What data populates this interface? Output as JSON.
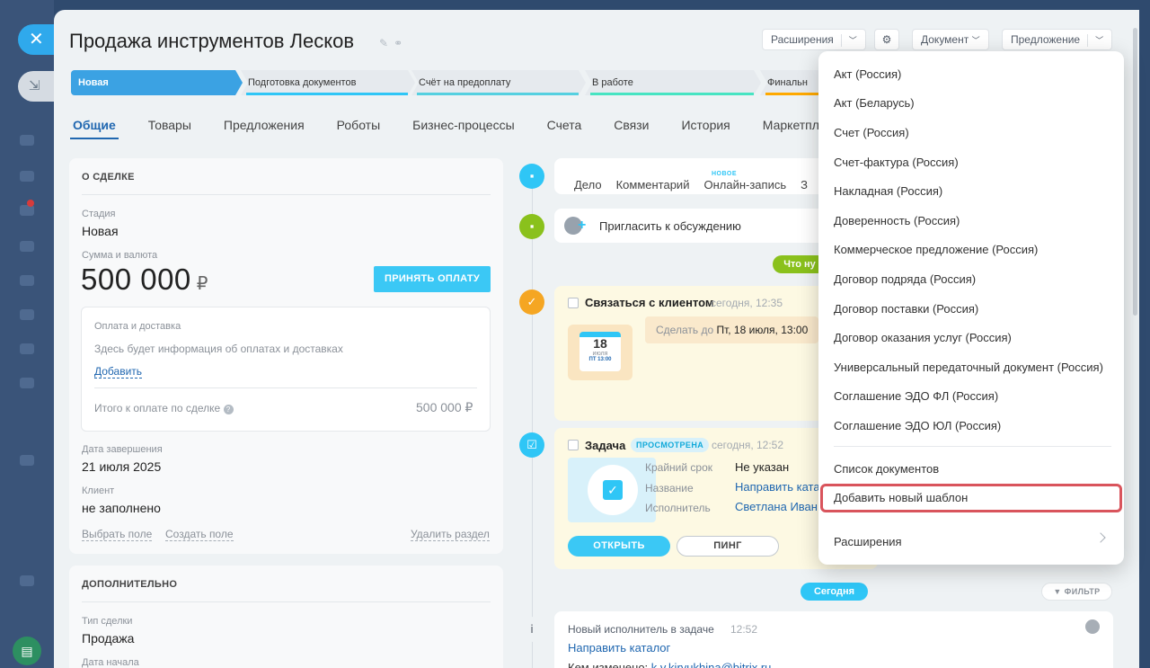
{
  "deal": {
    "title": "Продажа инструментов Лесков"
  },
  "header": {
    "extensions_label": "Расширения",
    "document_label": "Документ",
    "offer_label": "Предложение"
  },
  "stages": [
    {
      "label": "Новая",
      "color": "#3ba2e3"
    },
    {
      "label": "Подготовка документов",
      "color": "#2fc6f6"
    },
    {
      "label": "Счёт на предоплату",
      "color": "#55d0e0"
    },
    {
      "label": "В работе",
      "color": "#47e4c2"
    },
    {
      "label": "Финальн",
      "color": "#ffa900"
    }
  ],
  "tabs": [
    "Общие",
    "Товары",
    "Предложения",
    "Роботы",
    "Бизнес-процессы",
    "Счета",
    "Связи",
    "История",
    "Маркетплейс"
  ],
  "about": {
    "heading": "О СДЕЛКЕ",
    "stage_label": "Стадия",
    "stage_value": "Новая",
    "amount_label": "Сумма и валюта",
    "amount_value": "500 000",
    "currency": "₽",
    "accept_payment": "ПРИНЯТЬ ОПЛАТУ",
    "payment_title": "Оплата и доставка",
    "payment_hint": "Здесь будет информация об оплатах и доставках",
    "add_link": "Добавить",
    "total_label": "Итого к оплате по сделке",
    "total_value": "500 000 ₽",
    "close_date_label": "Дата завершения",
    "close_date_value": "21 июля 2025",
    "client_label": "Клиент",
    "client_value": "не заполнено",
    "choose_field": "Выбрать поле",
    "create_field": "Создать поле",
    "delete_section": "Удалить раздел"
  },
  "extra": {
    "heading": "ДОПОЛНИТЕЛЬНО",
    "type_label": "Тип сделки",
    "type_value": "Продажа",
    "start_label": "Дата начала"
  },
  "timeline": {
    "tabs": [
      "Дело",
      "Комментарий",
      "Онлайн-запись",
      "З"
    ],
    "new_badge": "НОВОЕ",
    "invite": "Пригласить к обсуждению",
    "pill_todo": "Что ну",
    "activity": {
      "title": "Связаться с клиентом",
      "time": "сегодня, 12:35",
      "cal_day": "18",
      "cal_month": "июля",
      "cal_footer": "ПТ 13:00",
      "deadline_prefix": "Сделать до",
      "deadline_value": "Пт, 18 июля, 13:00"
    },
    "task": {
      "title": "Задача",
      "badge": "ПРОСМОТРЕНА",
      "time": "сегодня, 12:52",
      "deadline_label": "Крайний срок",
      "deadline_value": "Не указан",
      "name_label": "Название",
      "name_value": "Направить ката",
      "assignee_label": "Исполнитель",
      "assignee_value": "Светлана Иван",
      "open_btn": "ОТКРЫТЬ",
      "ping_btn": "ПИНГ"
    },
    "today_pill": "Сегодня",
    "filter_btn": "ФИЛЬТР",
    "log": {
      "title": "Новый исполнитель в задаче",
      "time": "12:52",
      "link": "Направить каталог",
      "changed_prefix": "Кем изменено:",
      "changed_value": "k.v.kiryukhina@bitrix.ru"
    }
  },
  "menu": {
    "items": [
      "Акт (Россия)",
      "Акт (Беларусь)",
      "Счет (Россия)",
      "Счет-фактура (Россия)",
      "Накладная (Россия)",
      "Доверенность (Россия)",
      "Коммерческое предложение (Россия)",
      "Договор подряда (Россия)",
      "Договор поставки (Россия)",
      "Договор оказания услуг (Россия)",
      "Универсальный передаточный документ (Россия)",
      "Соглашение ЭДО ФЛ (Россия)",
      "Соглашение ЭДО ЮЛ (Россия)"
    ],
    "doc_list": "Список документов",
    "add_template": "Добавить новый шаблон",
    "extensions": "Расширения"
  },
  "colors": {
    "accent": "#3bc8f5",
    "link": "#2067b0",
    "highlight": "#d9545c",
    "timeline_green": "#8ac11c",
    "timeline_orange": "#f5a623",
    "timeline_blue": "#2fc6f6"
  }
}
